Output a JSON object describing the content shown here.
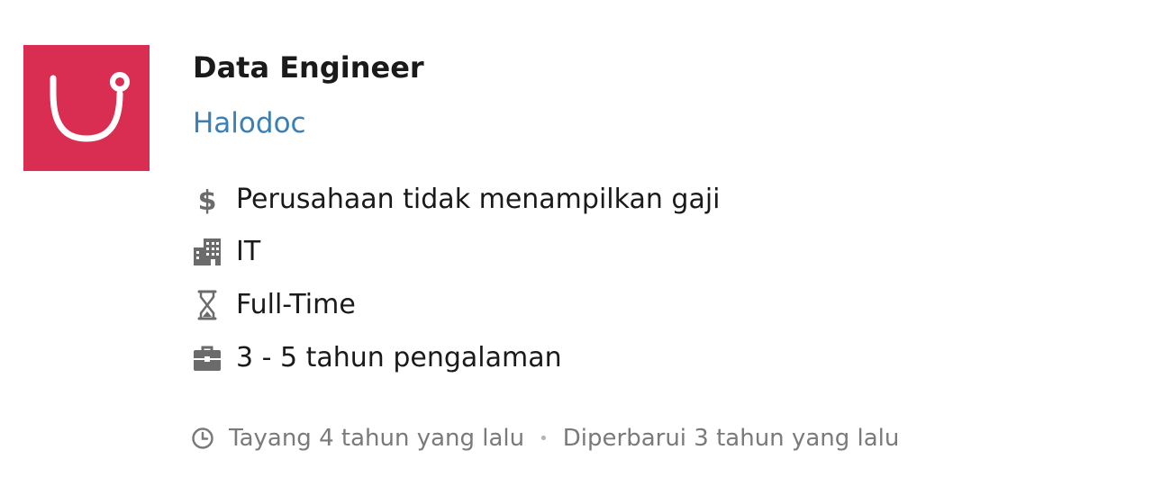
{
  "company_logo": {
    "icon": "stethoscope-icon",
    "background_color": "#d92d52"
  },
  "job": {
    "title": "Data Engineer",
    "company": "Halodoc"
  },
  "details": [
    {
      "icon": "dollar-icon",
      "text": "Perusahaan tidak menampilkan gaji"
    },
    {
      "icon": "building-icon",
      "text": "IT"
    },
    {
      "icon": "hourglass-icon",
      "text": "Full-Time"
    },
    {
      "icon": "briefcase-icon",
      "text": "3 - 5 tahun pengalaman"
    }
  ],
  "meta": {
    "icon": "clock-icon",
    "posted": "Tayang 4 tahun yang lalu",
    "separator": "•",
    "updated": "Diperbarui 3 tahun yang lalu"
  },
  "colors": {
    "link": "#3a7fb6",
    "muted": "#7a7a7a",
    "icon": "#6b6b6b"
  }
}
